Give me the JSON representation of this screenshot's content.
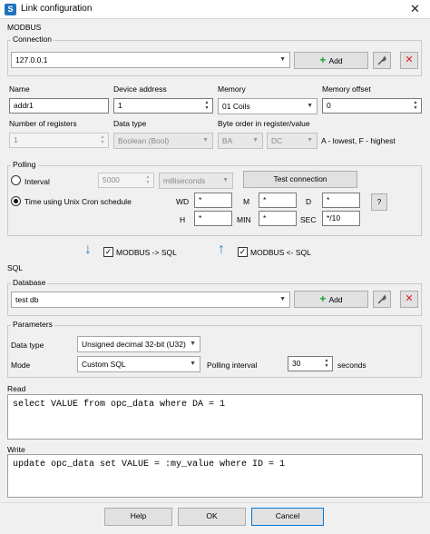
{
  "window": {
    "title": "Link configuration",
    "close_glyph": "✕",
    "icon": "app-icon"
  },
  "modbus": {
    "section": "MODBUS",
    "connection": {
      "group": "Connection",
      "value": "127.0.0.1",
      "add_label": "Add"
    },
    "labels": {
      "name": "Name",
      "device_address": "Device address",
      "memory": "Memory",
      "memory_offset": "Memory offset",
      "num_registers": "Number of registers",
      "data_type": "Data type",
      "byte_order": "Byte order in register/value"
    },
    "values": {
      "name": "addr1",
      "device_address": "1",
      "memory": "01 Coils",
      "memory_offset": "0",
      "num_registers": "1",
      "data_type": "Boolean (Bool)",
      "byte_order_1": "BA",
      "byte_order_2": "DC",
      "byte_order_hint": "A - lowest, F - highest"
    },
    "polling": {
      "group": "Polling",
      "interval_label": "Interval",
      "interval_value": "5000",
      "interval_unit": "milliseconds",
      "test_button": "Test connection",
      "cron_label": "Time using Unix Cron schedule",
      "wd_label": "WD",
      "wd": "*",
      "m_label": "M",
      "m": "*",
      "d_label": "D",
      "d": "*",
      "h_label": "H",
      "h": "*",
      "min_label": "MIN",
      "min": "*",
      "sec_label": "SEC",
      "sec": "*/10",
      "help_glyph": "?"
    }
  },
  "direction": {
    "to_sql": "MODBUS -> SQL",
    "from_sql": "MODBUS <- SQL",
    "to_sql_checked": true,
    "from_sql_checked": true
  },
  "sql": {
    "section": "SQL",
    "database": {
      "group": "Database",
      "value": "test db",
      "add_label": "Add"
    },
    "parameters": {
      "group": "Parameters",
      "data_type_label": "Data type",
      "data_type": "Unsigned decimal 32-bit (U32)",
      "mode_label": "Mode",
      "mode": "Custom SQL",
      "polling_interval_label": "Polling interval",
      "polling_interval": "30",
      "seconds_label": "seconds"
    },
    "read": {
      "label": "Read",
      "query": "select VALUE from opc_data where DA = 1"
    },
    "write": {
      "label": "Write",
      "query": "update opc_data set VALUE = :my_value where ID = 1"
    }
  },
  "footer": {
    "help": "Help",
    "ok": "OK",
    "cancel": "Cancel"
  },
  "colors": {
    "accent": "#0078d7",
    "add_plus": "#22a03a",
    "delete_x": "#d42020",
    "arrow": "#1e88d6"
  }
}
